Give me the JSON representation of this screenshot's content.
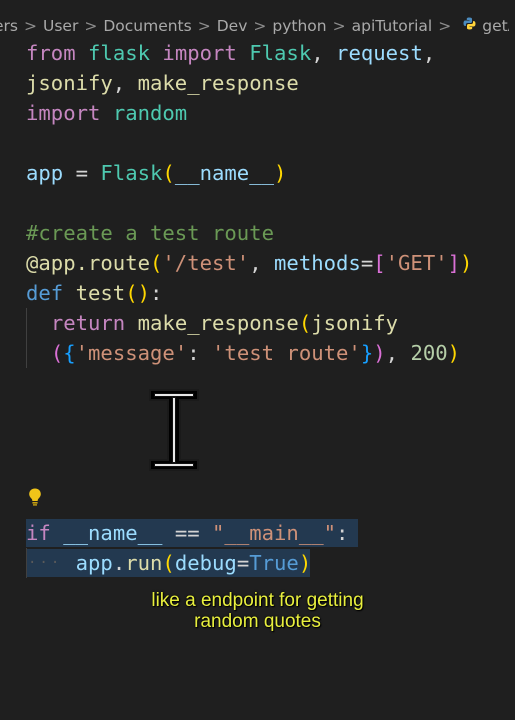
{
  "breadcrumb": {
    "items": [
      "ers",
      "User",
      "Documents",
      "Dev",
      "python",
      "apiTutorial",
      "getAPItutor"
    ],
    "separator": ">",
    "file_icon": "python-file-icon"
  },
  "editor": {
    "language": "python",
    "lines": [
      [
        [
          "kw-ctrl",
          "from"
        ],
        [
          "plain",
          " "
        ],
        [
          "mod",
          "flask"
        ],
        [
          "plain",
          " "
        ],
        [
          "kw-ctrl",
          "import"
        ],
        [
          "plain",
          " "
        ],
        [
          "mod",
          "Flask"
        ],
        [
          "plain",
          ", "
        ],
        [
          "var",
          "request"
        ],
        [
          "plain",
          ","
        ]
      ],
      [
        [
          "fn",
          "jsonify"
        ],
        [
          "plain",
          ", "
        ],
        [
          "fn",
          "make_response"
        ]
      ],
      [
        [
          "kw-ctrl",
          "import"
        ],
        [
          "plain",
          " "
        ],
        [
          "mod",
          "random"
        ]
      ],
      [],
      [
        [
          "var",
          "app"
        ],
        [
          "plain",
          " = "
        ],
        [
          "mod",
          "Flask"
        ],
        [
          "bracket1",
          "("
        ],
        [
          "var",
          "__name__"
        ],
        [
          "bracket1",
          ")"
        ]
      ],
      [],
      [
        [
          "cmt",
          "#create a test route"
        ]
      ],
      [
        [
          "fn",
          "@app.route"
        ],
        [
          "bracket1",
          "("
        ],
        [
          "str",
          "'/test'"
        ],
        [
          "plain",
          ", "
        ],
        [
          "var",
          "methods"
        ],
        [
          "plain",
          "="
        ],
        [
          "bracket2",
          "["
        ],
        [
          "str",
          "'GET'"
        ],
        [
          "bracket2",
          "]"
        ],
        [
          "bracket1",
          ")"
        ]
      ],
      [
        [
          "kw",
          "def"
        ],
        [
          "plain",
          " "
        ],
        [
          "fn",
          "test"
        ],
        [
          "bracket1",
          "("
        ],
        [
          "bracket1",
          ")"
        ],
        [
          "plain",
          ":"
        ]
      ],
      [
        [
          "plain",
          "  "
        ],
        [
          "kw-ctrl",
          "return"
        ],
        [
          "plain",
          " "
        ],
        [
          "fn",
          "make_response"
        ],
        [
          "bracket1",
          "("
        ],
        [
          "fn",
          "jsonify"
        ]
      ],
      [
        [
          "plain",
          "  "
        ],
        [
          "bracket2",
          "("
        ],
        [
          "bracket3",
          "{"
        ],
        [
          "str",
          "'message'"
        ],
        [
          "plain",
          ": "
        ],
        [
          "str",
          "'test route'"
        ],
        [
          "bracket3",
          "}"
        ],
        [
          "bracket2",
          ")"
        ],
        [
          "plain",
          ", "
        ],
        [
          "num",
          "200"
        ],
        [
          "bracket1",
          ")"
        ]
      ],
      [],
      [],
      [],
      [],
      [],
      [
        [
          "kw-ctrl",
          "if"
        ],
        [
          "plain",
          " "
        ],
        [
          "var",
          "__name__"
        ],
        [
          "plain",
          " == "
        ],
        [
          "str",
          "\"__main__\""
        ],
        [
          "plain",
          ":"
        ]
      ],
      [
        [
          "plain",
          "    "
        ],
        [
          "var",
          "app"
        ],
        [
          "plain",
          "."
        ],
        [
          "fn",
          "run"
        ],
        [
          "bracket1",
          "("
        ],
        [
          "var",
          "debug"
        ],
        [
          "plain",
          "="
        ],
        [
          "kw",
          "True"
        ],
        [
          "bracket1",
          ")"
        ]
      ]
    ]
  },
  "caption": {
    "line1": "like a endpoint for getting",
    "line2": "random quotes"
  },
  "colors": {
    "background": "#1f1f1f",
    "caption": "#e8ef3e",
    "selection": "#264f78",
    "lightbulb": "#f0c419"
  },
  "icons": {
    "lightbulb": "lightbulb-icon",
    "cursor": "text-cursor-ibeam-icon"
  }
}
